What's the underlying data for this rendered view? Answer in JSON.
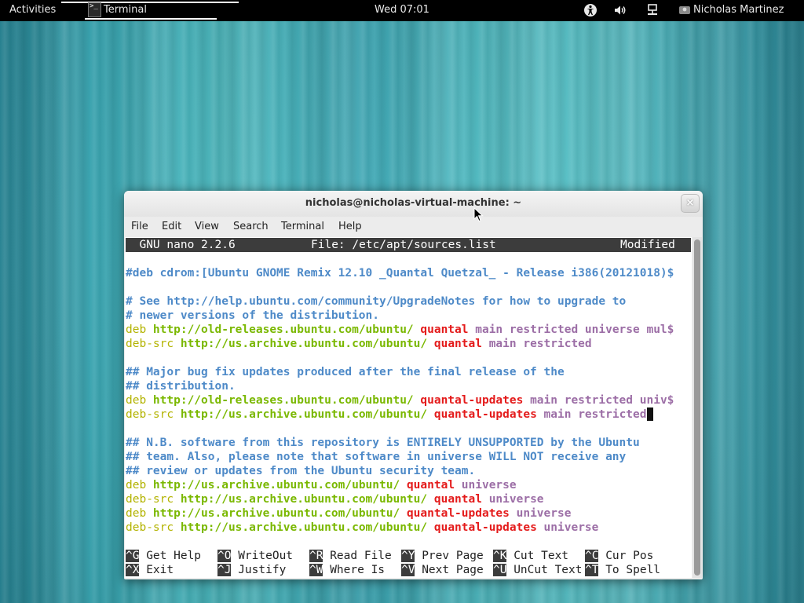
{
  "topbar": {
    "activities": "Activities",
    "app_name": "Terminal",
    "app_icon_glyph": ">_",
    "clock": "Wed 07:01",
    "username": "Nicholas Martinez",
    "indicators": [
      "accessibility-icon",
      "volume-icon",
      "network-icon",
      "user-icon"
    ]
  },
  "window": {
    "title": "nicholas@nicholas-virtual-machine: ~",
    "close_glyph": "×",
    "menu": [
      "File",
      "Edit",
      "View",
      "Search",
      "Terminal",
      "Help"
    ]
  },
  "nano": {
    "header": {
      "version": "  GNU nano 2.2.6",
      "file": "File: /etc/apt/sources.list",
      "status": "Modified"
    },
    "lines": [
      [
        {
          "t": "#deb cdrom:[Ubuntu GNOME Remix 12.10 _Quantal Quetzal_ - Release i386(20121018)$",
          "c": "comment"
        }
      ],
      [],
      [
        {
          "t": "# See http://help.ubuntu.com/community/UpgradeNotes for how to upgrade to",
          "c": "comment"
        }
      ],
      [
        {
          "t": "# newer versions of the distribution.",
          "c": "comment"
        }
      ],
      [
        {
          "t": "deb ",
          "c": "yellow"
        },
        {
          "t": "http://old-releases.ubuntu.com/ubuntu/ ",
          "c": "green"
        },
        {
          "t": "quantal",
          "c": "red"
        },
        {
          "t": " main restricted universe mul$",
          "c": "purple"
        }
      ],
      [
        {
          "t": "deb-src ",
          "c": "yellow"
        },
        {
          "t": "http://us.archive.ubuntu.com/ubuntu/ ",
          "c": "green"
        },
        {
          "t": "quantal",
          "c": "red"
        },
        {
          "t": " main restricted",
          "c": "purple"
        }
      ],
      [],
      [
        {
          "t": "## Major bug fix updates produced after the final release of the",
          "c": "comment"
        }
      ],
      [
        {
          "t": "## distribution.",
          "c": "comment"
        }
      ],
      [
        {
          "t": "deb ",
          "c": "yellow"
        },
        {
          "t": "http://old-releases.ubuntu.com/ubuntu/ ",
          "c": "green"
        },
        {
          "t": "quantal-updates",
          "c": "red"
        },
        {
          "t": " main restricted univ$",
          "c": "purple"
        }
      ],
      [
        {
          "t": "deb-src ",
          "c": "yellow"
        },
        {
          "t": "http://us.archive.ubuntu.com/ubuntu/ ",
          "c": "green"
        },
        {
          "t": "quantal-updates",
          "c": "red"
        },
        {
          "t": " main restricted",
          "c": "purple"
        },
        {
          "t": "",
          "c": "cursor"
        }
      ],
      [],
      [
        {
          "t": "## N.B. software from this repository is ENTIRELY UNSUPPORTED by the Ubuntu",
          "c": "comment"
        }
      ],
      [
        {
          "t": "## team. Also, please note that software in universe WILL NOT receive any",
          "c": "comment"
        }
      ],
      [
        {
          "t": "## review or updates from the Ubuntu security team.",
          "c": "comment"
        }
      ],
      [
        {
          "t": "deb ",
          "c": "yellow"
        },
        {
          "t": "http://us.archive.ubuntu.com/ubuntu/ ",
          "c": "green"
        },
        {
          "t": "quantal",
          "c": "red"
        },
        {
          "t": " universe",
          "c": "purple"
        }
      ],
      [
        {
          "t": "deb-src ",
          "c": "yellow"
        },
        {
          "t": "http://us.archive.ubuntu.com/ubuntu/ ",
          "c": "green"
        },
        {
          "t": "quantal",
          "c": "red"
        },
        {
          "t": " universe",
          "c": "purple"
        }
      ],
      [
        {
          "t": "deb ",
          "c": "yellow"
        },
        {
          "t": "http://us.archive.ubuntu.com/ubuntu/ ",
          "c": "green"
        },
        {
          "t": "quantal-updates",
          "c": "red"
        },
        {
          "t": " universe",
          "c": "purple"
        }
      ],
      [
        {
          "t": "deb-src ",
          "c": "yellow"
        },
        {
          "t": "http://us.archive.ubuntu.com/ubuntu/ ",
          "c": "green"
        },
        {
          "t": "quantal-updates",
          "c": "red"
        },
        {
          "t": " universe",
          "c": "purple"
        }
      ]
    ],
    "shortcuts": [
      [
        {
          "key": "^G",
          "label": " Get Help "
        },
        {
          "key": "^O",
          "label": " WriteOut "
        },
        {
          "key": "^R",
          "label": " Read File "
        },
        {
          "key": "^Y",
          "label": " Prev Page "
        },
        {
          "key": "^K",
          "label": " Cut Text  "
        },
        {
          "key": "^C",
          "label": " Cur Pos"
        }
      ],
      [
        {
          "key": "^X",
          "label": " Exit     "
        },
        {
          "key": "^J",
          "label": " Justify  "
        },
        {
          "key": "^W",
          "label": " Where Is  "
        },
        {
          "key": "^V",
          "label": " Next Page "
        },
        {
          "key": "^U",
          "label": " UnCut Text"
        },
        {
          "key": "^T",
          "label": " To Spell"
        }
      ]
    ]
  }
}
